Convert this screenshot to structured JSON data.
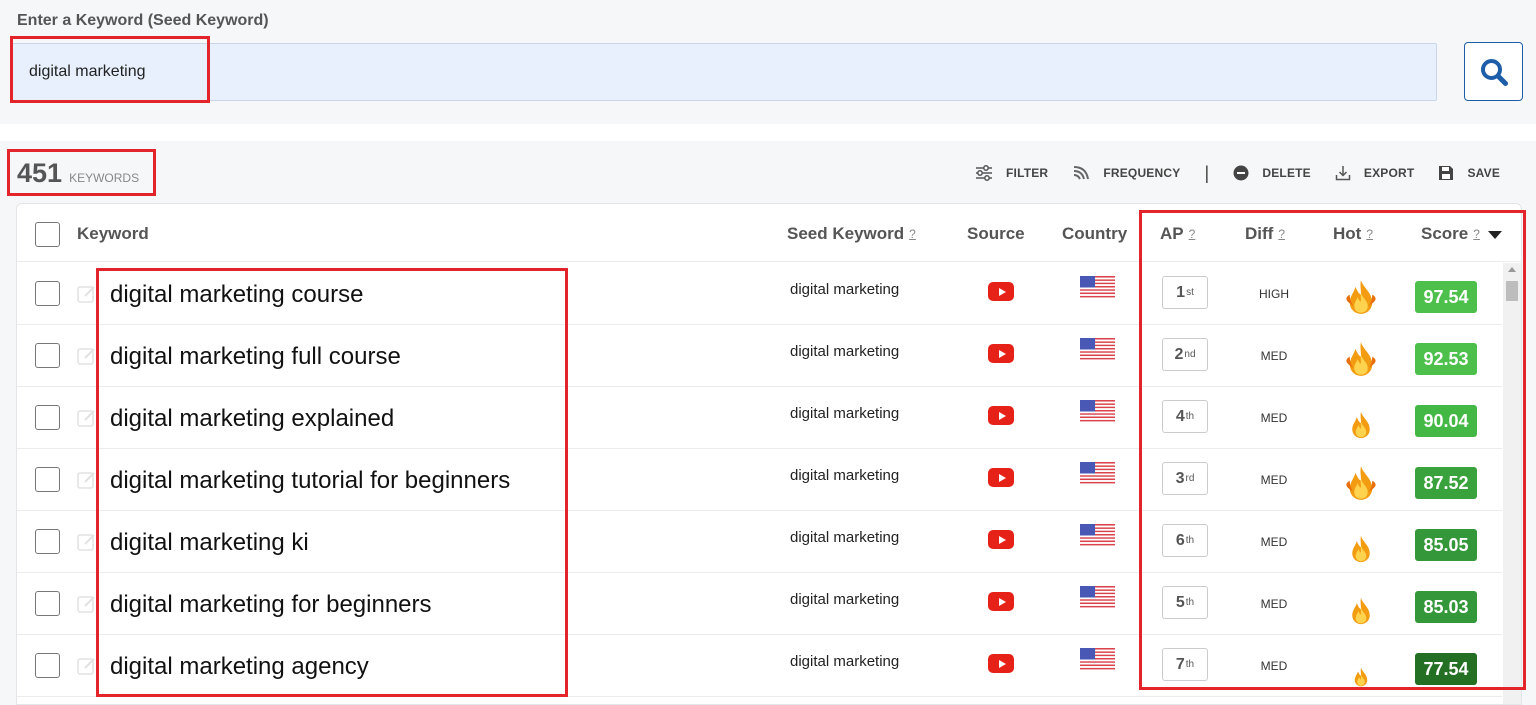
{
  "search": {
    "label": "Enter a Keyword (Seed Keyword)",
    "value": "digital marketing"
  },
  "summary": {
    "count": "451",
    "count_label": "KEYWORDS"
  },
  "toolbar": {
    "filter": "FILTER",
    "frequency": "FREQUENCY",
    "separator": "|",
    "delete": "DELETE",
    "export": "EXPORT",
    "save": "SAVE"
  },
  "table": {
    "headers": {
      "keyword": "Keyword",
      "seed": "Seed Keyword",
      "source": "Source",
      "country": "Country",
      "ap": "AP",
      "diff": "Diff",
      "hot": "Hot",
      "score": "Score",
      "help": "?"
    },
    "sort": {
      "column": "Score",
      "direction": "descending",
      "icon": "caret-down-icon"
    },
    "rows": [
      {
        "keyword": "digital marketing course",
        "seed": "digital marketing",
        "source": "youtube-icon",
        "country": "us-flag-icon",
        "ap": "1",
        "ap_suffix": "st",
        "diff": "HIGH",
        "hot_level": 3,
        "score": "97.54",
        "score_color": "#4cc04a"
      },
      {
        "keyword": "digital marketing full course",
        "seed": "digital marketing",
        "source": "youtube-icon",
        "country": "us-flag-icon",
        "ap": "2",
        "ap_suffix": "nd",
        "diff": "MED",
        "hot_level": 3,
        "score": "92.53",
        "score_color": "#4cc04a"
      },
      {
        "keyword": "digital marketing explained",
        "seed": "digital marketing",
        "source": "youtube-icon",
        "country": "us-flag-icon",
        "ap": "4",
        "ap_suffix": "th",
        "diff": "MED",
        "hot_level": 2,
        "score": "90.04",
        "score_color": "#44b844"
      },
      {
        "keyword": "digital marketing tutorial for beginners",
        "seed": "digital marketing",
        "source": "youtube-icon",
        "country": "us-flag-icon",
        "ap": "3",
        "ap_suffix": "rd",
        "diff": "MED",
        "hot_level": 3,
        "score": "87.52",
        "score_color": "#3aa23c"
      },
      {
        "keyword": "digital marketing ki",
        "seed": "digital marketing",
        "source": "youtube-icon",
        "country": "us-flag-icon",
        "ap": "6",
        "ap_suffix": "th",
        "diff": "MED",
        "hot_level": 2,
        "score": "85.05",
        "score_color": "#34983a"
      },
      {
        "keyword": "digital marketing for beginners",
        "seed": "digital marketing",
        "source": "youtube-icon",
        "country": "us-flag-icon",
        "ap": "5",
        "ap_suffix": "th",
        "diff": "MED",
        "hot_level": 2,
        "score": "85.03",
        "score_color": "#34983a"
      },
      {
        "keyword": "digital marketing agency",
        "seed": "digital marketing",
        "source": "youtube-icon",
        "country": "us-flag-icon",
        "ap": "7",
        "ap_suffix": "th",
        "diff": "MED",
        "hot_level": 1,
        "score": "77.54",
        "score_color": "#236f24"
      }
    ]
  },
  "colors": {
    "highlight": "#e3242b",
    "search_bg": "#e8f0fe",
    "search_button_border": "#1e5ea8",
    "youtube_red": "#e62117"
  }
}
